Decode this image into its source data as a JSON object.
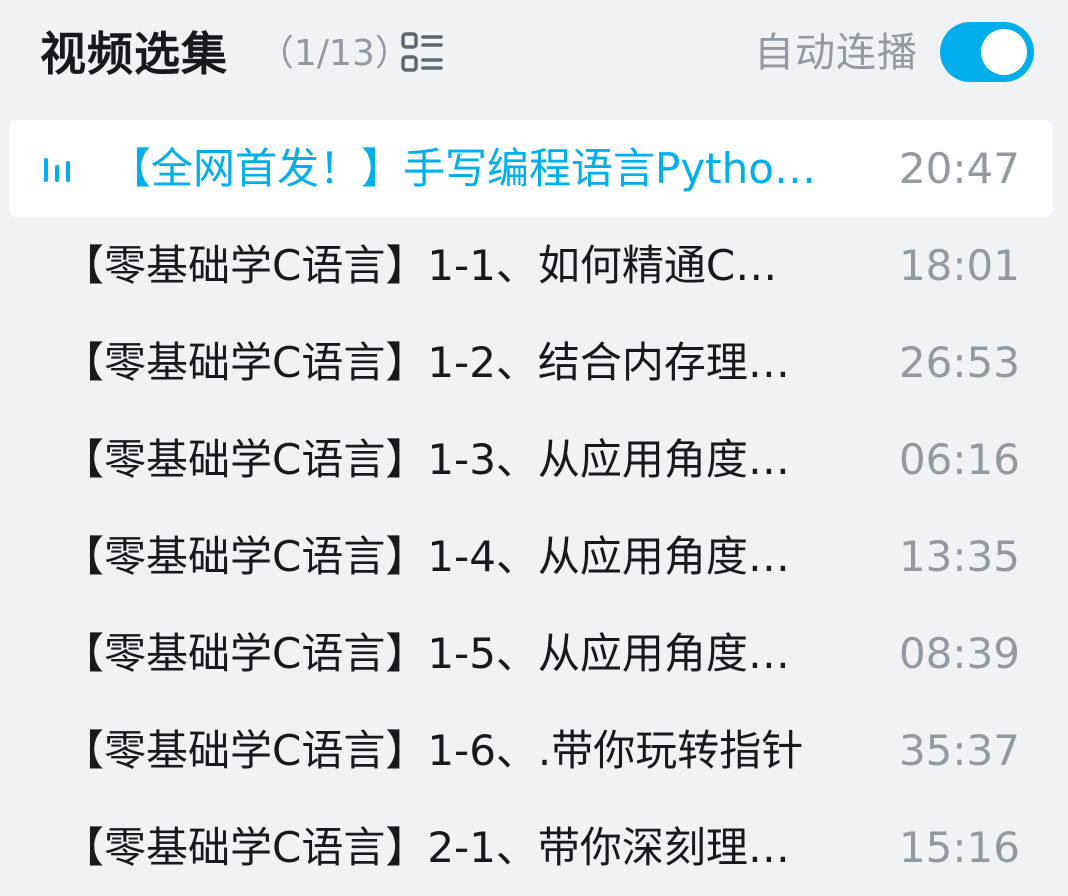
{
  "header": {
    "title": "视频选集",
    "count": "（1/13）",
    "list_mode_icon": "list-view-icon",
    "autoplay_label": "自动连播",
    "autoplay_on": true,
    "accent_color": "#00aeec"
  },
  "episodes": [
    {
      "title": "【全网首发！】手写编程语言Pytho…",
      "duration": "20:47",
      "playing": true
    },
    {
      "title": "【零基础学C语言】1-1、如何精通C…",
      "duration": "18:01"
    },
    {
      "title": "【零基础学C语言】1-2、结合内存理…",
      "duration": "26:53"
    },
    {
      "title": "【零基础学C语言】1-3、从应用角度…",
      "duration": "06:16"
    },
    {
      "title": "【零基础学C语言】1-4、从应用角度…",
      "duration": "13:35"
    },
    {
      "title": "【零基础学C语言】1-5、从应用角度…",
      "duration": "08:39"
    },
    {
      "title": "【零基础学C语言】1-6、.带你玩转指针",
      "duration": "35:37"
    },
    {
      "title": "【零基础学C语言】2-1、带你深刻理…",
      "duration": "15:16"
    }
  ]
}
